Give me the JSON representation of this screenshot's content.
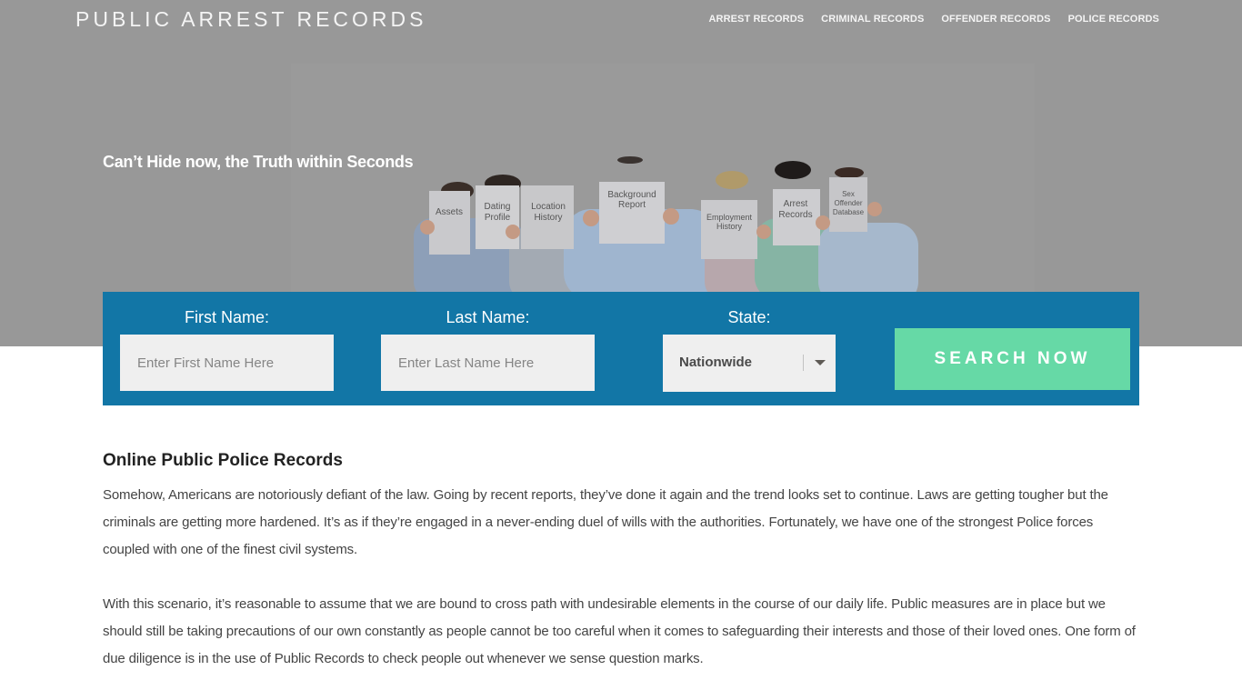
{
  "header": {
    "site_title": "PUBLIC ARREST RECORDS",
    "nav": [
      {
        "label": "ARREST RECORDS"
      },
      {
        "label": "CRIMINAL RECORDS"
      },
      {
        "label": "OFFENDER RECORDS"
      },
      {
        "label": "POLICE RECORDS"
      }
    ]
  },
  "hero": {
    "tagline": "Can’t Hide now, the Truth within Seconds",
    "image_signs": [
      "Assets",
      "Dating Profile",
      "Location History",
      "Background Report",
      "Employment History",
      "Arrest Records",
      "Sex Offender Database"
    ]
  },
  "search": {
    "first_name_label": "First Name:",
    "first_name_placeholder": "Enter First Name Here",
    "first_name_value": "",
    "last_name_label": "Last Name:",
    "last_name_placeholder": "Enter Last Name Here",
    "last_name_value": "",
    "state_label": "State:",
    "state_selected": "Nationwide",
    "button_label": "SEARCH NOW"
  },
  "content": {
    "heading": "Online Public Police Records",
    "paragraphs": [
      "Somehow, Americans are notoriously defiant of the law. Going by recent reports, they’ve done it again and the trend looks set to continue. Laws are getting tougher but the criminals are getting more hardened. It’s as if they’re engaged in a never-ending duel of wills with the authorities. Fortunately, we have one of the strongest Police forces coupled with one of the finest civil systems.",
      "With this scenario, it’s reasonable to assume that we are bound to cross path with undesirable elements in the course of our daily life. Public measures are in place but we should still be taking precautions of our own constantly as people cannot be too careful when it comes to safeguarding their interests and those of their loved ones. One form of due diligence is in the use of Public Records to check people out whenever we sense question marks."
    ]
  },
  "colors": {
    "hero_bg": "#989898",
    "search_bar_bg": "#1276a6",
    "button_bg": "#66d9a6"
  }
}
